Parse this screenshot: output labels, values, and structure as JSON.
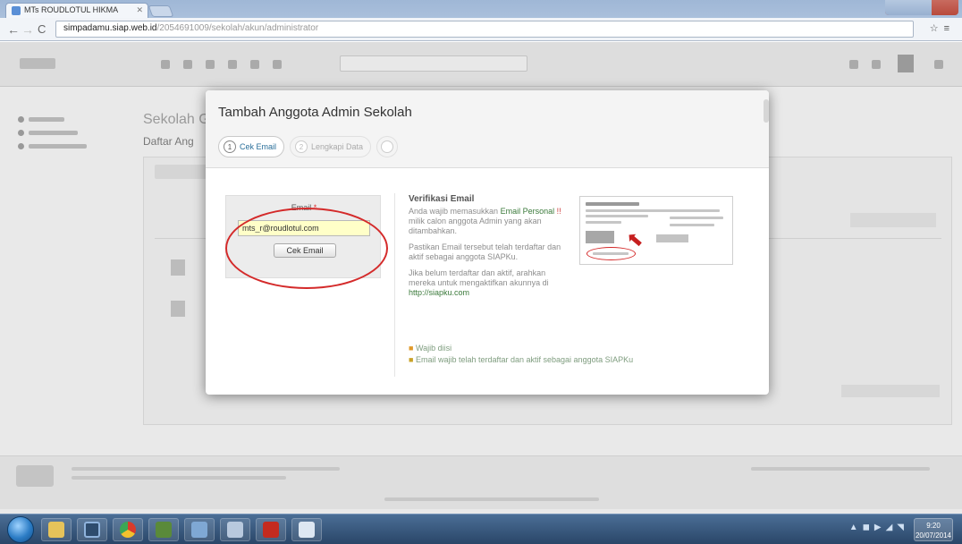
{
  "browser": {
    "tab_title": "MTs ROUDLOTUL HIKMA",
    "url_host": "simpadamu.siap.web.id",
    "url_path": "/2054691009/sekolah/akun/administrator"
  },
  "page": {
    "title": "Sekolah Grup Akun",
    "subtitle": "Daftar Ang"
  },
  "modal": {
    "title": "Tambah Anggota Admin Sekolah",
    "steps": [
      {
        "num": "1",
        "label": "Cek Email"
      },
      {
        "num": "2",
        "label": "Lengkapi Data"
      }
    ],
    "email_label": "Email",
    "required_mark": "*",
    "email_value": "mts_r@roudlotul.com",
    "cek_button": "Cek Email",
    "verif_title": "Verifikasi Email",
    "verif_p1_a": "Anda wajib memasukkan",
    "verif_p1_link": "Email Personal",
    "verif_p1_b": "milik calon anggota Admin yang akan ditambahkan.",
    "verif_p2": "Pastikan Email tersebut telah terdaftar dan aktif sebagai anggota SIAPKu.",
    "verif_p3": "Jika belum terdaftar dan aktif, arahkan mereka untuk mengaktifkan akunnya di",
    "verif_link": "http://siapku.com",
    "legend1": "Wajib diisi",
    "legend2": "Email wajib telah terdaftar dan aktif sebagai anggota SIAPKu"
  },
  "taskbar": {
    "clock_time": "9:20",
    "clock_date": "20/07/2014"
  }
}
